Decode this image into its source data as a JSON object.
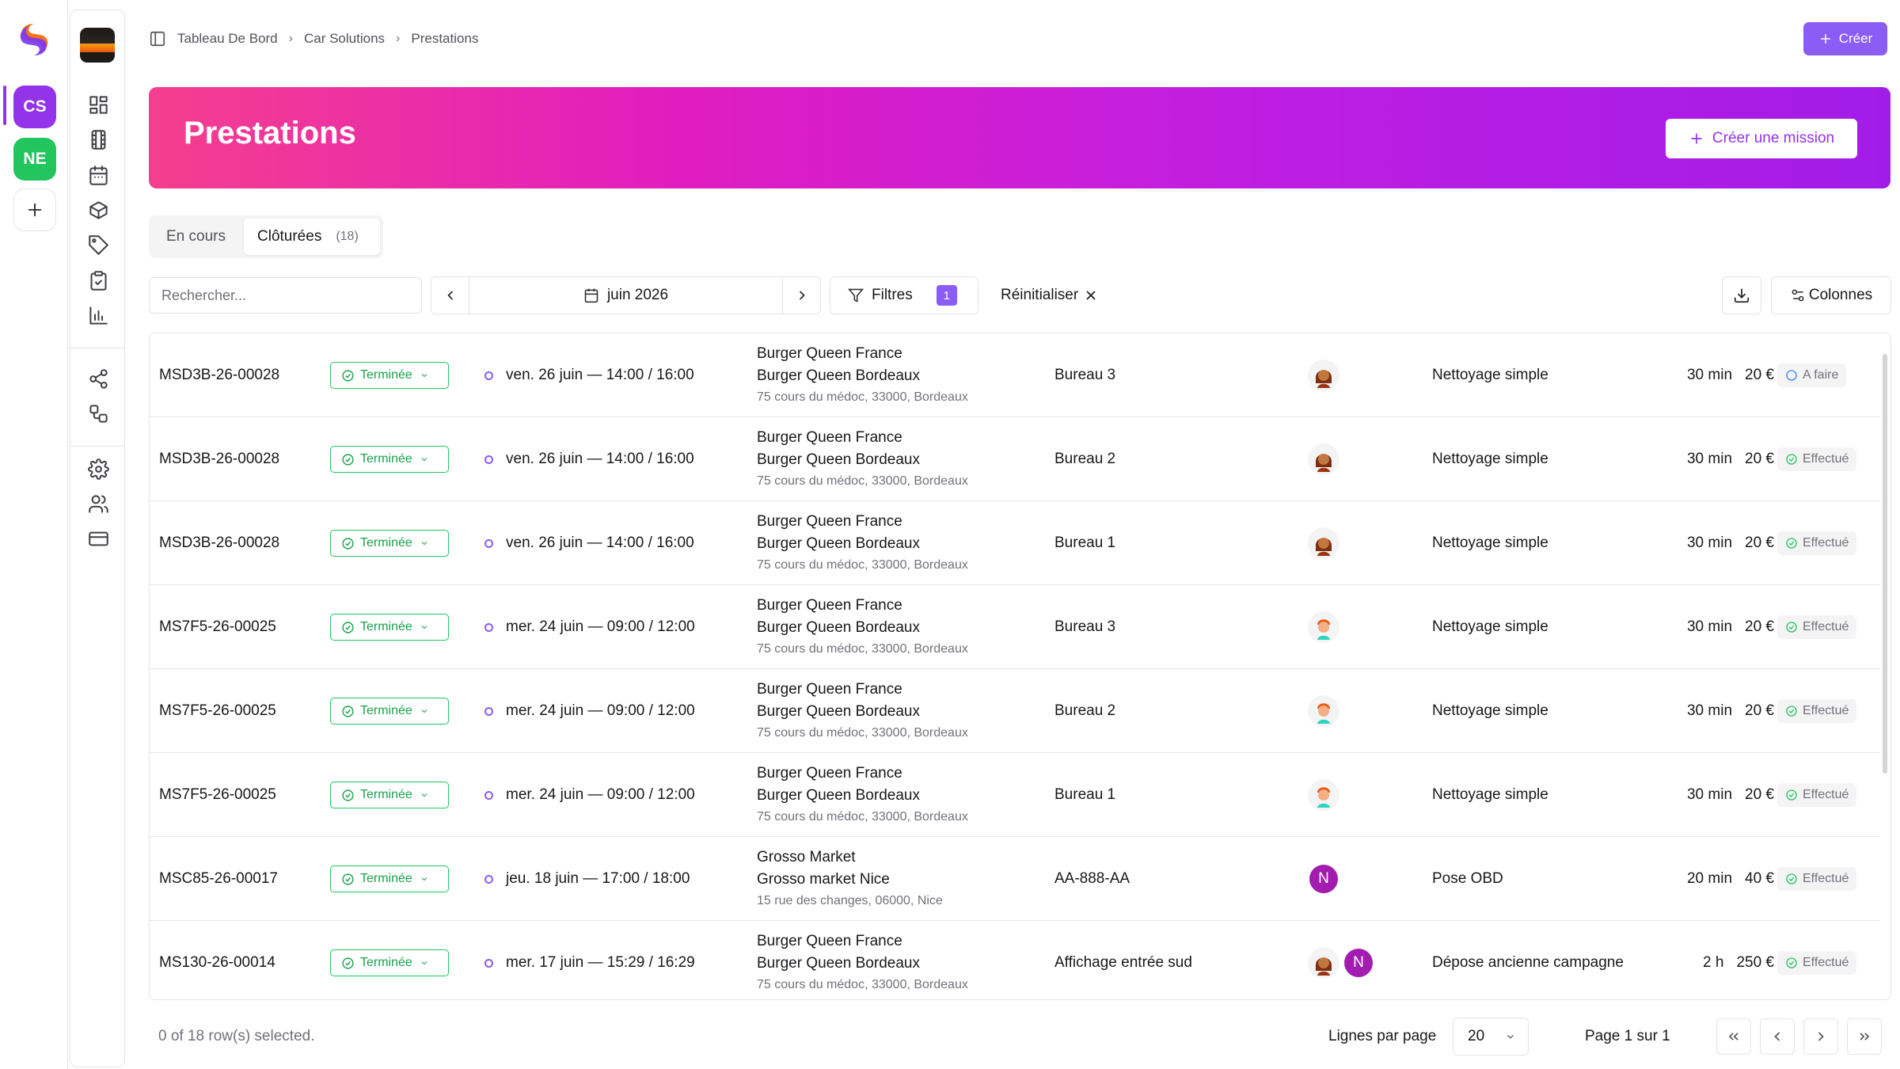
{
  "workspaces": [
    {
      "initials": "CS",
      "color": "#9333ea",
      "active": true
    },
    {
      "initials": "NE",
      "color": "#22c55e",
      "active": false
    }
  ],
  "breadcrumb": [
    "Tableau De Bord",
    "Car Solutions",
    "Prestations"
  ],
  "header": {
    "create_label": "Créer"
  },
  "banner": {
    "title": "Prestations",
    "mission_label": "Créer une mission"
  },
  "tabs": {
    "active_label": "En cours",
    "closed_label": "Clôturées",
    "closed_count": "(18)"
  },
  "toolbar": {
    "search_placeholder": "Rechercher...",
    "month": "juin 2026",
    "filters_label": "Filtres",
    "filters_count": "1",
    "reset_label": "Réinitialiser",
    "columns_label": "Colonnes"
  },
  "rows": [
    {
      "ref": "MSD3B-26-00028",
      "status": "Terminée",
      "date": "ven. 26 juin — 14:00 / 16:00",
      "client": "Burger Queen France",
      "site": "Burger Queen Bordeaux",
      "address": "75 cours du médoc, 33000, Bordeaux",
      "place": "Bureau 3",
      "avatars": [
        "woman"
      ],
      "service": "Nettoyage simple",
      "duration": "30 min",
      "price": "20 €",
      "state": "A faire"
    },
    {
      "ref": "MSD3B-26-00028",
      "status": "Terminée",
      "date": "ven. 26 juin — 14:00 / 16:00",
      "client": "Burger Queen France",
      "site": "Burger Queen Bordeaux",
      "address": "75 cours du médoc, 33000, Bordeaux",
      "place": "Bureau 2",
      "avatars": [
        "woman"
      ],
      "service": "Nettoyage simple",
      "duration": "30 min",
      "price": "20 €",
      "state": "Effectué"
    },
    {
      "ref": "MSD3B-26-00028",
      "status": "Terminée",
      "date": "ven. 26 juin — 14:00 / 16:00",
      "client": "Burger Queen France",
      "site": "Burger Queen Bordeaux",
      "address": "75 cours du médoc, 33000, Bordeaux",
      "place": "Bureau 1",
      "avatars": [
        "woman"
      ],
      "service": "Nettoyage simple",
      "duration": "30 min",
      "price": "20 €",
      "state": "Effectué"
    },
    {
      "ref": "MS7F5-26-00025",
      "status": "Terminée",
      "date": "mer. 24 juin — 09:00 / 12:00",
      "client": "Burger Queen France",
      "site": "Burger Queen Bordeaux",
      "address": "75 cours du médoc, 33000, Bordeaux",
      "place": "Bureau 3",
      "avatars": [
        "man"
      ],
      "service": "Nettoyage simple",
      "duration": "30 min",
      "price": "20 €",
      "state": "Effectué"
    },
    {
      "ref": "MS7F5-26-00025",
      "status": "Terminée",
      "date": "mer. 24 juin — 09:00 / 12:00",
      "client": "Burger Queen France",
      "site": "Burger Queen Bordeaux",
      "address": "75 cours du médoc, 33000, Bordeaux",
      "place": "Bureau 2",
      "avatars": [
        "man"
      ],
      "service": "Nettoyage simple",
      "duration": "30 min",
      "price": "20 €",
      "state": "Effectué"
    },
    {
      "ref": "MS7F5-26-00025",
      "status": "Terminée",
      "date": "mer. 24 juin — 09:00 / 12:00",
      "client": "Burger Queen France",
      "site": "Burger Queen Bordeaux",
      "address": "75 cours du médoc, 33000, Bordeaux",
      "place": "Bureau 1",
      "avatars": [
        "man"
      ],
      "service": "Nettoyage simple",
      "duration": "30 min",
      "price": "20 €",
      "state": "Effectué"
    },
    {
      "ref": "MSC85-26-00017",
      "status": "Terminée",
      "date": "jeu. 18 juin — 17:00 / 18:00",
      "client": "Grosso Market",
      "site": "Grosso market Nice",
      "address": "15 rue des changes, 06000, Nice",
      "place": "AA-888-AA",
      "avatars": [
        "N"
      ],
      "service": "Pose OBD",
      "duration": "20 min",
      "price": "40 €",
      "state": "Effectué"
    },
    {
      "ref": "MS130-26-00014",
      "status": "Terminée",
      "date": "mer. 17 juin — 15:29 / 16:29",
      "client": "Burger Queen France",
      "site": "Burger Queen Bordeaux",
      "address": "75 cours du médoc, 33000, Bordeaux",
      "place": "Affichage entrée sud",
      "avatars": [
        "woman",
        "N"
      ],
      "service": "Dépose ancienne campagne",
      "duration": "2 h",
      "price": "250 €",
      "state": "Effectué"
    }
  ],
  "footer": {
    "selected": "0 of 18 row(s) selected.",
    "rows_per_page_label": "Lignes par page",
    "rows_per_page": "20",
    "page_label": "Page 1 sur 1"
  },
  "icons": {
    "sidebar": [
      "layout-grid-icon",
      "film-icon",
      "calendar-icon",
      "package-icon",
      "tag-icon",
      "clipboard-check-icon",
      "bar-chart-icon",
      "share-icon",
      "workflow-icon",
      "settings-icon",
      "users-icon",
      "credit-card-icon"
    ]
  }
}
